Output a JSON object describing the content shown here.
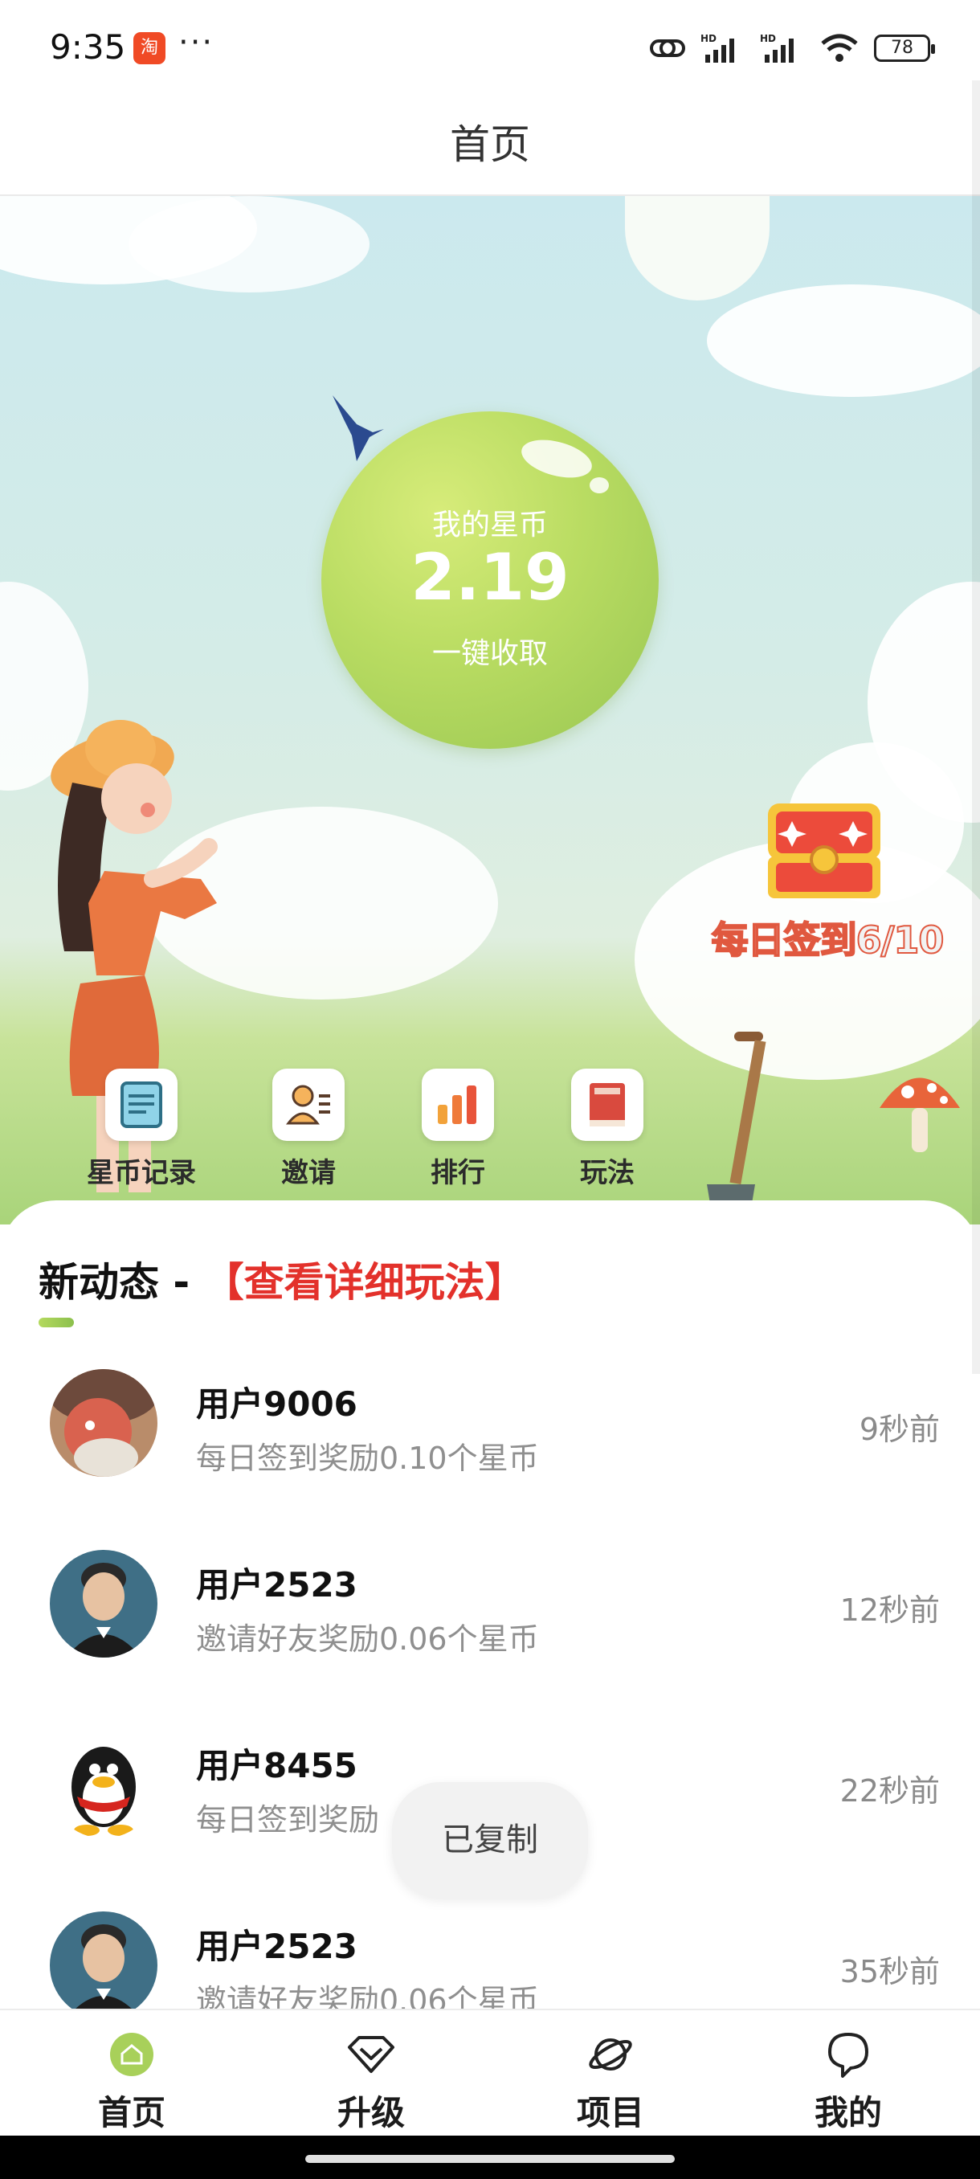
{
  "status_bar": {
    "time": "9:35",
    "app_icon_text": "淘",
    "more": "···",
    "battery": "78"
  },
  "header": {
    "title": "首页"
  },
  "hero": {
    "coin_label": "我的星币",
    "coin_value": "2.19",
    "collect_label": "一键收取",
    "checkin_text": "每日签到6/10"
  },
  "quick_menu": [
    {
      "label": "星币记录",
      "icon": "record-icon"
    },
    {
      "label": "邀请",
      "icon": "invite-icon"
    },
    {
      "label": "排行",
      "icon": "ranking-icon"
    },
    {
      "label": "玩法",
      "icon": "rules-book-icon"
    }
  ],
  "feed": {
    "title": "新动态 - ",
    "link": "【查看详细玩法】",
    "items": [
      {
        "user": "用户9006",
        "desc": "每日签到奖励0.10个星币",
        "time": "9秒前"
      },
      {
        "user": "用户2523",
        "desc": "邀请好友奖励0.06个星币",
        "time": "12秒前"
      },
      {
        "user": "用户8455",
        "desc": "每日签到奖励",
        "time": "22秒前"
      },
      {
        "user": "用户2523",
        "desc": "邀请好友奖励0.06个星币",
        "time": "35秒前"
      }
    ]
  },
  "toast": "已复制",
  "bottom_nav": [
    {
      "label": "首页",
      "icon": "home-icon"
    },
    {
      "label": "升级",
      "icon": "diamond-icon"
    },
    {
      "label": "项目",
      "icon": "planet-icon"
    },
    {
      "label": "我的",
      "icon": "profile-icon"
    }
  ],
  "colors": {
    "accent_green": "#9cc954",
    "link_red": "#e3312b"
  }
}
